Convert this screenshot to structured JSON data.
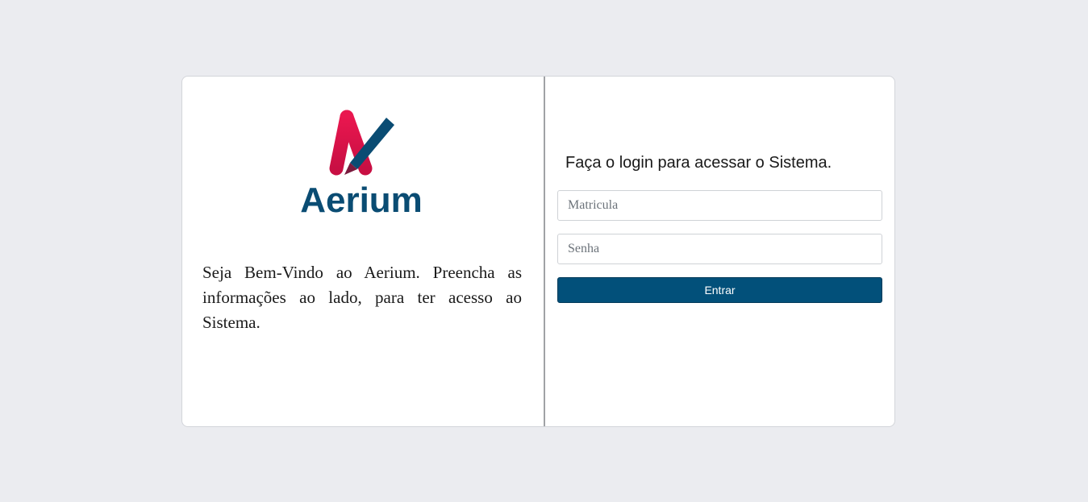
{
  "brand": {
    "name": "Aerium",
    "logo_icon": "aerium-logo-icon",
    "colors": {
      "primary": "#02507a",
      "accent_red": "#e0154f",
      "accent_dark_red": "#b80d3c",
      "text_blue": "#0a4c73"
    }
  },
  "left_panel": {
    "welcome_text": "Seja Bem-Vindo ao Aerium. Preencha as informações ao lado, para ter acesso ao Sistema."
  },
  "login": {
    "heading": "Faça o login para acessar o Sistema.",
    "matricula_placeholder": "Matricula",
    "matricula_value": "",
    "senha_placeholder": "Senha",
    "senha_value": "",
    "submit_label": "Entrar"
  }
}
